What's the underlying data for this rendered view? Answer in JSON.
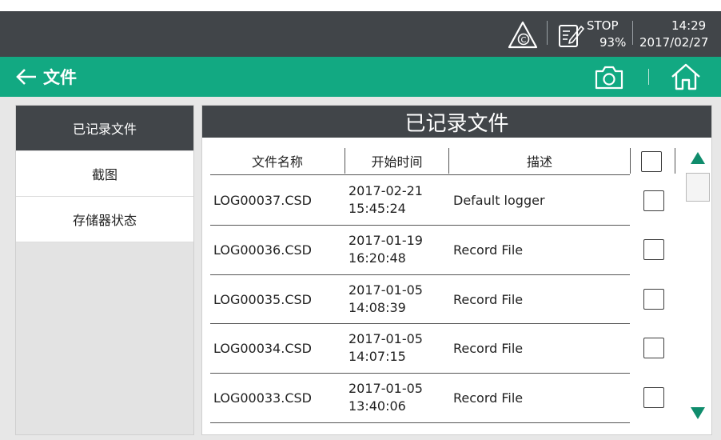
{
  "status_bar": {
    "state": "STOP",
    "battery": "93%",
    "time": "14:29",
    "date": "2017/02/27",
    "icons": [
      "warning-icon",
      "record-edit-icon"
    ]
  },
  "title_bar": {
    "title": "文件",
    "icons": [
      "back-arrow-icon",
      "camera-icon",
      "home-icon"
    ],
    "color": "#12a982"
  },
  "sidebar": {
    "items": [
      {
        "label": "已记录文件",
        "active": true
      },
      {
        "label": "截图",
        "active": false
      },
      {
        "label": "存储器状态",
        "active": false
      }
    ]
  },
  "main": {
    "header": "已记录文件",
    "columns": [
      "文件名称",
      "开始时间",
      "描述"
    ],
    "rows": [
      {
        "name": "LOG00037.CSD",
        "date": "2017-02-21",
        "time": "15:45:24",
        "desc": "Default logger"
      },
      {
        "name": "LOG00036.CSD",
        "date": "2017-01-19",
        "time": "16:20:48",
        "desc": "Record File"
      },
      {
        "name": "LOG00035.CSD",
        "date": "2017-01-05",
        "time": "14:08:39",
        "desc": "Record File"
      },
      {
        "name": "LOG00034.CSD",
        "date": "2017-01-05",
        "time": "14:07:15",
        "desc": "Record File"
      },
      {
        "name": "LOG00033.CSD",
        "date": "2017-01-05",
        "time": "13:40:06",
        "desc": "Record File"
      }
    ]
  },
  "colors": {
    "status_bg": "#414549",
    "accent": "#12a982",
    "scroll_arrow": "#0f8c6c"
  }
}
